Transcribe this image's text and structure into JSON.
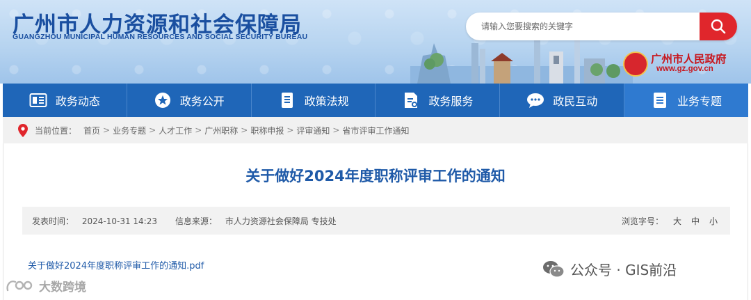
{
  "header": {
    "site_title": "广州市人力资源和社会保障局",
    "site_subtitle": "GUANGZHOU MUNICIPAL HUMAN RESOURCES AND SOCIAL SECURITY BUREAU",
    "search_placeholder": "请输入您要搜索的关键字",
    "gov_name": "广州市人民政府",
    "gov_url": "www.gz.gov.cn",
    "accent_color": "#1a4fa0",
    "search_button_color": "#e0262c"
  },
  "nav": {
    "items": [
      {
        "label": "政务动态",
        "icon": "newspaper-icon"
      },
      {
        "label": "政务公开",
        "icon": "star-circle-icon"
      },
      {
        "label": "政策法规",
        "icon": "document-list-icon"
      },
      {
        "label": "政务服务",
        "icon": "service-doc-icon"
      },
      {
        "label": "政民互动",
        "icon": "chat-bubble-icon"
      },
      {
        "label": "业务专题",
        "icon": "topic-doc-icon"
      }
    ],
    "bg_color": "#1f66b8"
  },
  "breadcrumb": {
    "prefix": "当前位置：",
    "items": [
      "首页",
      "业务专题",
      "人才工作",
      "广州职称",
      "职称申报",
      "评审通知",
      "省市评审工作通知"
    ],
    "separator": ">"
  },
  "article": {
    "title": "关于做好2024年度职称评审工作的通知",
    "publish_label": "发表时间：",
    "publish_time": "2024-10-31 14:23",
    "source_label": "信息来源：",
    "source": "市人力资源社会保障局 专技处",
    "font_size_label": "浏览字号：",
    "font_sizes": [
      "大",
      "中",
      "小"
    ],
    "attachment": "关于做好2024年度职称评审工作的通知.pdf"
  },
  "watermarks": {
    "wechat": "公众号 · GIS前沿",
    "bottom": "大数跨境"
  }
}
